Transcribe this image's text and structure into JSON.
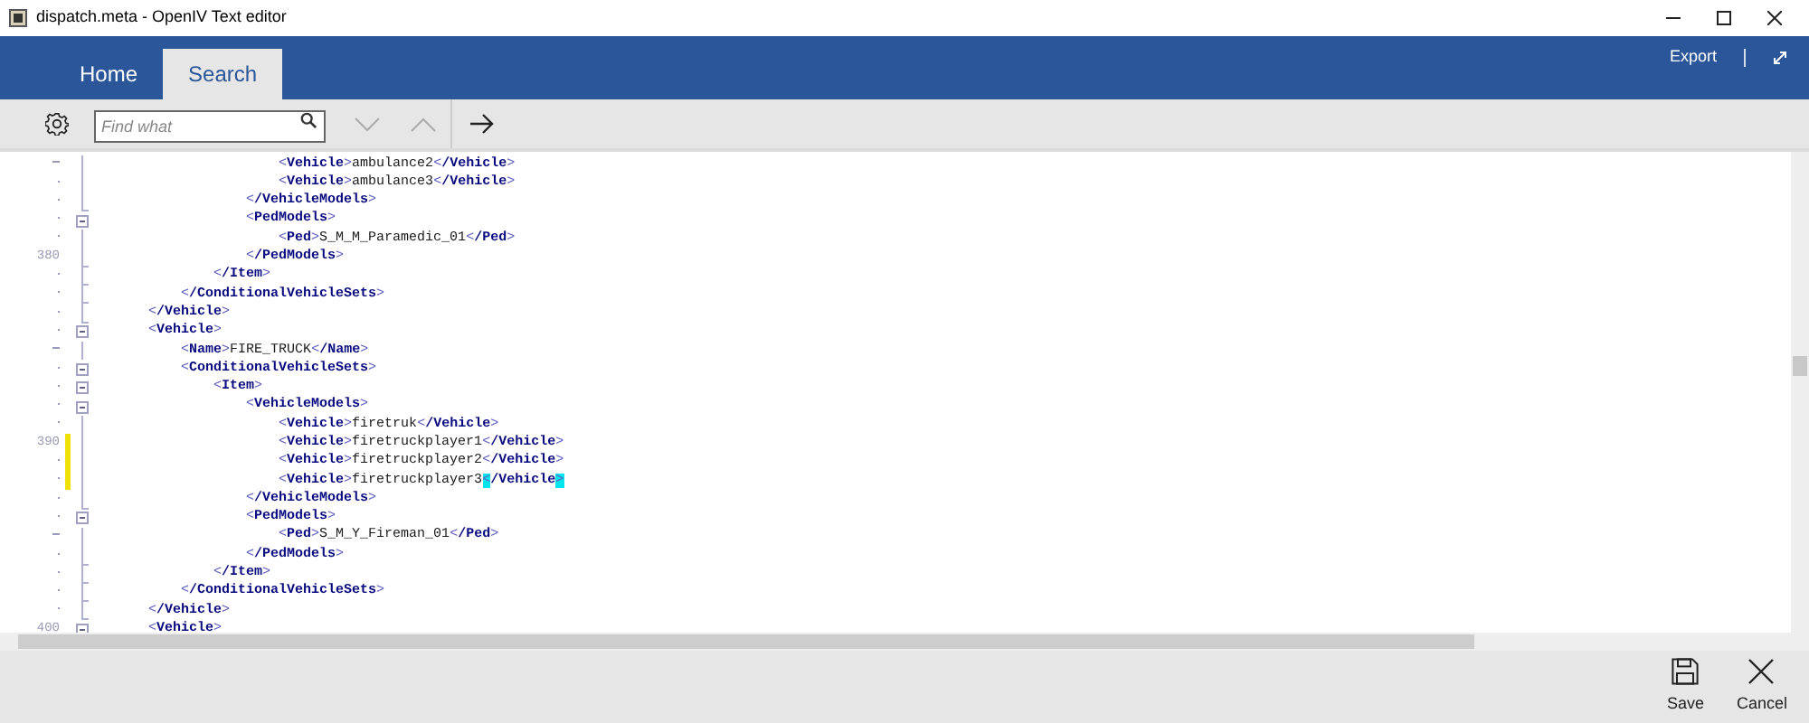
{
  "window": {
    "title": "dispatch.meta - OpenIV Text editor"
  },
  "ribbon": {
    "tabs": [
      {
        "label": "Home",
        "selected": false
      },
      {
        "label": "Search",
        "selected": true
      }
    ],
    "export": "Export"
  },
  "toolbar": {
    "search": {
      "placeholder": "Find what"
    }
  },
  "editor": {
    "nodes": [
      {
        "closing": "</Vehicle>",
        "children": [
          {
            "closing": "</ConditionalVehicleSets>",
            "children": [
              {
                "closing": "</Item>",
                "children": [
                  {
                    "closing": "</VehicleModels>",
                    "children": [
                      {
                        "text": "<Vehicle>ambulance2</Vehicle>"
                      },
                      {
                        "text": "<Vehicle>ambulance3</Vehicle>"
                      }
                    ]
                  },
                  {
                    "text": "<PedModels>",
                    "closing": "</PedModels>",
                    "closing_number": "380",
                    "children": [
                      {
                        "text": "<Ped>S_M_M_Paramedic_01</Ped>"
                      }
                    ]
                  }
                ]
              }
            ]
          }
        ]
      },
      {
        "text": "<Vehicle>",
        "closing": "</Vehicle>",
        "children": [
          {
            "text": "<Name>FIRE_TRUCK</Name>"
          },
          {
            "text": "<ConditionalVehicleSets>",
            "closing": "</ConditionalVehicleSets>",
            "children": [
              {
                "text": "<Item>",
                "closing": "</Item>",
                "children": [
                  {
                    "text": "<VehicleModels>",
                    "closing": "</VehicleModels>",
                    "children": [
                      {
                        "text": "<Vehicle>firetruk</Vehicle>"
                      },
                      {
                        "text": "<Vehicle>firetruckplayer1</Vehicle>",
                        "number": "390",
                        "changed": true
                      },
                      {
                        "text": "<Vehicle>firetruckplayer2</Vehicle>",
                        "changed": true
                      },
                      {
                        "text": "<Vehicle>firetruckplayer3</Vehicle>",
                        "changed": true,
                        "bracket_match": true
                      }
                    ]
                  },
                  {
                    "text": "<PedModels>",
                    "closing": "</PedModels>",
                    "children": [
                      {
                        "text": "<Ped>S_M_Y_Fireman_01</Ped>"
                      }
                    ]
                  }
                ]
              }
            ]
          }
        ]
      },
      {
        "text": "<Vehicle>",
        "number": "400",
        "collapsible": true
      }
    ]
  },
  "footer": {
    "buttons": [
      {
        "kind": "save",
        "label": "Save"
      },
      {
        "kind": "cancel",
        "label": "Cancel"
      }
    ]
  }
}
